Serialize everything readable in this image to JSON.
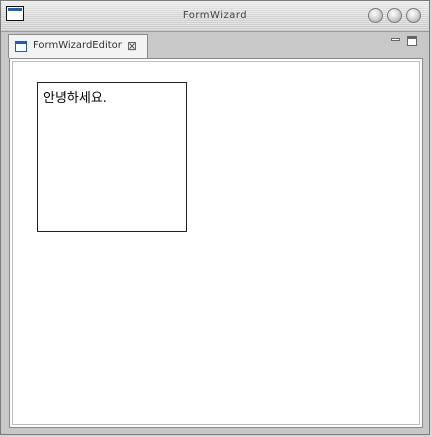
{
  "window": {
    "title": "FormWizard"
  },
  "tabs": [
    {
      "label": "FormWizardEditor",
      "close_icon": "close-icon"
    }
  ],
  "icons": {
    "app": "window-icon",
    "tab": "editor-icon",
    "minimize_view": "minimize-icon",
    "maximize_view": "maximize-icon"
  },
  "canvas": {
    "label_text": "안녕하세요."
  }
}
